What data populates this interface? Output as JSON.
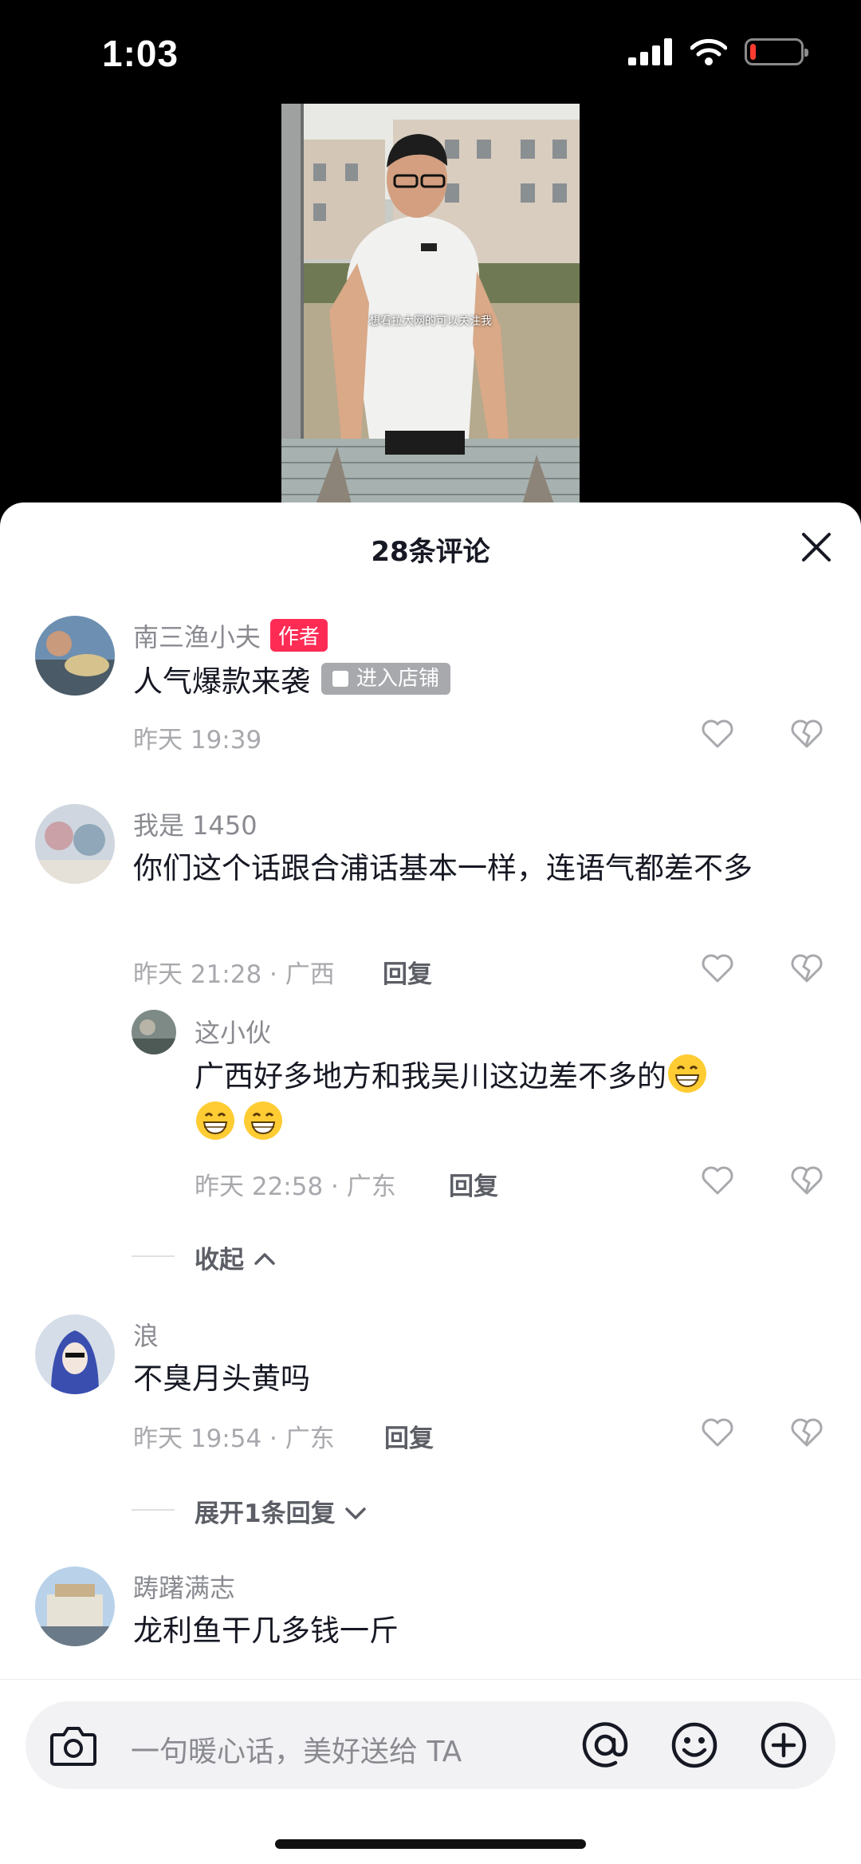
{
  "status_bar": {
    "time": "1:03",
    "battery_level": 0.1,
    "battery_color": "#ff3b30"
  },
  "video": {
    "caption": "想看拉大网的可以关注我"
  },
  "sheet": {
    "title": "28条评论"
  },
  "comments": [
    {
      "user": "南三渔小夫",
      "author_tag": "作者",
      "text": "人气爆款来袭",
      "shop_tag": "进入店铺",
      "time": "昨天 19:39"
    },
    {
      "user": "我是 1450",
      "text": "你们这个话跟合浦话基本一样，连语气都差不多",
      "time": "昨天 21:28 · 广西",
      "reply": "回复",
      "replies": [
        {
          "user": "这小伙",
          "text": "广西好多地方和我吴川这边差不多的",
          "time": "昨天 22:58 · 广东",
          "reply": "回复"
        }
      ],
      "fold_label": "收起"
    },
    {
      "user": "浪",
      "text": "不臭月头黄吗",
      "time": "昨天 19:54 · 广东",
      "reply": "回复",
      "expand_label": "展开1条回复"
    },
    {
      "user": "踌躇满志",
      "text": "龙利鱼干几多钱一斤"
    }
  ],
  "input": {
    "placeholder": "一句暖心话，美好送给 TA"
  },
  "colors": {
    "accent": "#fe2c55",
    "text": "#161823",
    "muted": "#a8a9ad"
  },
  "icons": [
    "close-icon",
    "heart-icon",
    "broken-heart-icon",
    "camera-icon",
    "at-icon",
    "emoji-icon",
    "plus-circle-icon",
    "chevron-up-icon",
    "chevron-down-icon"
  ]
}
